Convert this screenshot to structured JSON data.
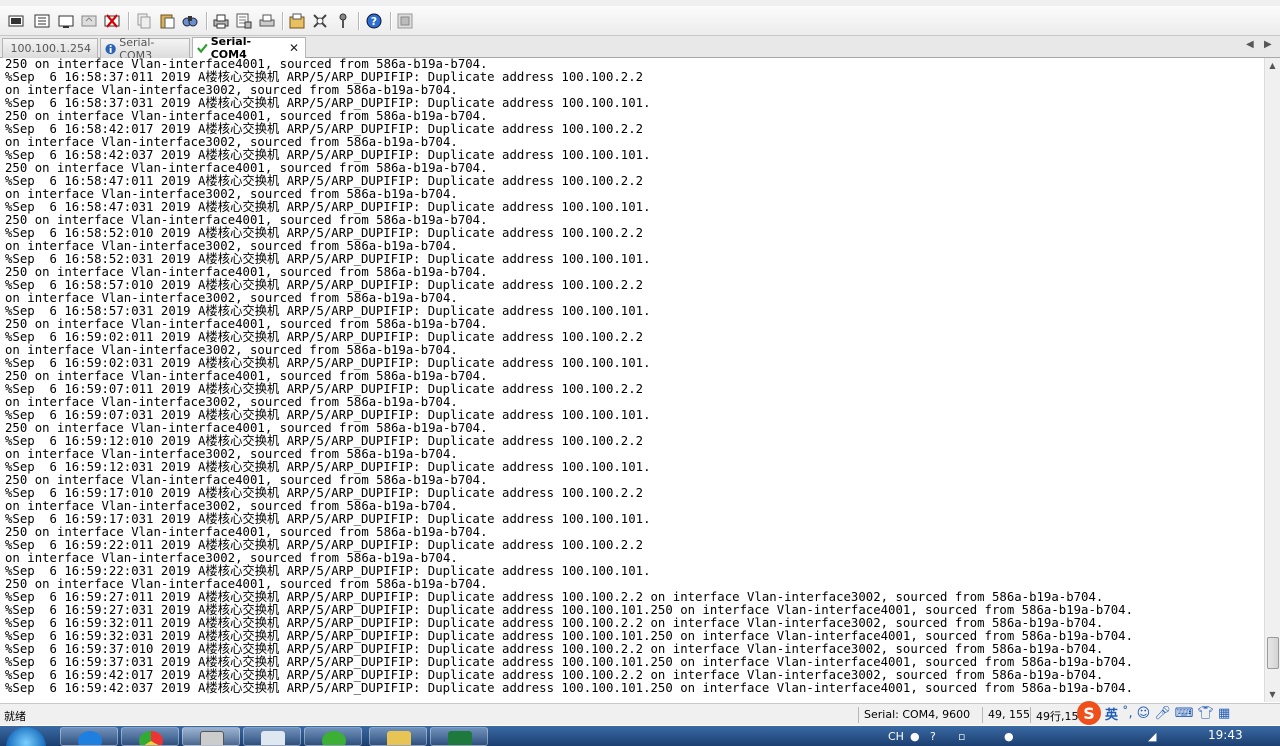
{
  "toolbar": {
    "icons": [
      "connect-icon",
      "quick-connect-icon",
      "connect-tab-icon",
      "reconnect-icon",
      "disconnect-icon",
      "copy-icon",
      "paste-icon",
      "copy-paste-icon",
      "find-icon",
      "print-icon",
      "print-setup-icon",
      "print-selection-icon",
      "session-options-icon",
      "global-options-icon",
      "keymap-icon",
      "help-icon",
      "sftp-icon"
    ]
  },
  "tabs": [
    {
      "label": "100.100.1.254",
      "status": "error"
    },
    {
      "label": "Serial-COM3",
      "status": "info"
    },
    {
      "label": "Serial-COM4",
      "status": "connected",
      "close": "✕"
    }
  ],
  "terminal": {
    "lines": [
      "250 on interface Vlan-interface4001, sourced from 586a-b19a-b704.",
      "%Sep  6 16:58:37:011 2019 A楼核心交换机 ARP/5/ARP_DUPIFIP: Duplicate address 100.100.2.2",
      "on interface Vlan-interface3002, sourced from 586a-b19a-b704.",
      "%Sep  6 16:58:37:031 2019 A楼核心交换机 ARP/5/ARP_DUPIFIP: Duplicate address 100.100.101.",
      "250 on interface Vlan-interface4001, sourced from 586a-b19a-b704.",
      "%Sep  6 16:58:42:017 2019 A楼核心交换机 ARP/5/ARP_DUPIFIP: Duplicate address 100.100.2.2",
      "on interface Vlan-interface3002, sourced from 586a-b19a-b704.",
      "%Sep  6 16:58:42:037 2019 A楼核心交换机 ARP/5/ARP_DUPIFIP: Duplicate address 100.100.101.",
      "250 on interface Vlan-interface4001, sourced from 586a-b19a-b704.",
      "%Sep  6 16:58:47:011 2019 A楼核心交换机 ARP/5/ARP_DUPIFIP: Duplicate address 100.100.2.2",
      "on interface Vlan-interface3002, sourced from 586a-b19a-b704.",
      "%Sep  6 16:58:47:031 2019 A楼核心交换机 ARP/5/ARP_DUPIFIP: Duplicate address 100.100.101.",
      "250 on interface Vlan-interface4001, sourced from 586a-b19a-b704.",
      "%Sep  6 16:58:52:010 2019 A楼核心交换机 ARP/5/ARP_DUPIFIP: Duplicate address 100.100.2.2",
      "on interface Vlan-interface3002, sourced from 586a-b19a-b704.",
      "%Sep  6 16:58:52:031 2019 A楼核心交换机 ARP/5/ARP_DUPIFIP: Duplicate address 100.100.101.",
      "250 on interface Vlan-interface4001, sourced from 586a-b19a-b704.",
      "%Sep  6 16:58:57:010 2019 A楼核心交换机 ARP/5/ARP_DUPIFIP: Duplicate address 100.100.2.2",
      "on interface Vlan-interface3002, sourced from 586a-b19a-b704.",
      "%Sep  6 16:58:57:031 2019 A楼核心交换机 ARP/5/ARP_DUPIFIP: Duplicate address 100.100.101.",
      "250 on interface Vlan-interface4001, sourced from 586a-b19a-b704.",
      "%Sep  6 16:59:02:011 2019 A楼核心交换机 ARP/5/ARP_DUPIFIP: Duplicate address 100.100.2.2",
      "on interface Vlan-interface3002, sourced from 586a-b19a-b704.",
      "%Sep  6 16:59:02:031 2019 A楼核心交换机 ARP/5/ARP_DUPIFIP: Duplicate address 100.100.101.",
      "250 on interface Vlan-interface4001, sourced from 586a-b19a-b704.",
      "%Sep  6 16:59:07:011 2019 A楼核心交换机 ARP/5/ARP_DUPIFIP: Duplicate address 100.100.2.2",
      "on interface Vlan-interface3002, sourced from 586a-b19a-b704.",
      "%Sep  6 16:59:07:031 2019 A楼核心交换机 ARP/5/ARP_DUPIFIP: Duplicate address 100.100.101.",
      "250 on interface Vlan-interface4001, sourced from 586a-b19a-b704.",
      "%Sep  6 16:59:12:010 2019 A楼核心交换机 ARP/5/ARP_DUPIFIP: Duplicate address 100.100.2.2",
      "on interface Vlan-interface3002, sourced from 586a-b19a-b704.",
      "%Sep  6 16:59:12:031 2019 A楼核心交换机 ARP/5/ARP_DUPIFIP: Duplicate address 100.100.101.",
      "250 on interface Vlan-interface4001, sourced from 586a-b19a-b704.",
      "%Sep  6 16:59:17:010 2019 A楼核心交换机 ARP/5/ARP_DUPIFIP: Duplicate address 100.100.2.2",
      "on interface Vlan-interface3002, sourced from 586a-b19a-b704.",
      "%Sep  6 16:59:17:031 2019 A楼核心交换机 ARP/5/ARP_DUPIFIP: Duplicate address 100.100.101.",
      "250 on interface Vlan-interface4001, sourced from 586a-b19a-b704.",
      "%Sep  6 16:59:22:011 2019 A楼核心交换机 ARP/5/ARP_DUPIFIP: Duplicate address 100.100.2.2",
      "on interface Vlan-interface3002, sourced from 586a-b19a-b704.",
      "%Sep  6 16:59:22:031 2019 A楼核心交换机 ARP/5/ARP_DUPIFIP: Duplicate address 100.100.101.",
      "250 on interface Vlan-interface4001, sourced from 586a-b19a-b704.",
      "%Sep  6 16:59:27:011 2019 A楼核心交换机 ARP/5/ARP_DUPIFIP: Duplicate address 100.100.2.2 on interface Vlan-interface3002, sourced from 586a-b19a-b704.",
      "%Sep  6 16:59:27:031 2019 A楼核心交换机 ARP/5/ARP_DUPIFIP: Duplicate address 100.100.101.250 on interface Vlan-interface4001, sourced from 586a-b19a-b704.",
      "%Sep  6 16:59:32:011 2019 A楼核心交换机 ARP/5/ARP_DUPIFIP: Duplicate address 100.100.2.2 on interface Vlan-interface3002, sourced from 586a-b19a-b704.",
      "%Sep  6 16:59:32:031 2019 A楼核心交换机 ARP/5/ARP_DUPIFIP: Duplicate address 100.100.101.250 on interface Vlan-interface4001, sourced from 586a-b19a-b704.",
      "%Sep  6 16:59:37:010 2019 A楼核心交换机 ARP/5/ARP_DUPIFIP: Duplicate address 100.100.2.2 on interface Vlan-interface3002, sourced from 586a-b19a-b704.",
      "%Sep  6 16:59:37:031 2019 A楼核心交换机 ARP/5/ARP_DUPIFIP: Duplicate address 100.100.101.250 on interface Vlan-interface4001, sourced from 586a-b19a-b704.",
      "%Sep  6 16:59:42:017 2019 A楼核心交换机 ARP/5/ARP_DUPIFIP: Duplicate address 100.100.2.2 on interface Vlan-interface3002, sourced from 586a-b19a-b704.",
      "%Sep  6 16:59:42:037 2019 A楼核心交换机 ARP/5/ARP_DUPIFIP: Duplicate address 100.100.101.250 on interface Vlan-interface4001, sourced from 586a-b19a-b704."
    ],
    "scroll_position": 0.97
  },
  "statusbar": {
    "ready": "就绪",
    "connection": "Serial: COM4, 9600",
    "cursor": "49, 155",
    "rows_cols": "49行,157"
  },
  "ime": {
    "logo": "S",
    "mode": "英"
  },
  "taskbar": {
    "lang": "CH",
    "clock": "19:43"
  }
}
